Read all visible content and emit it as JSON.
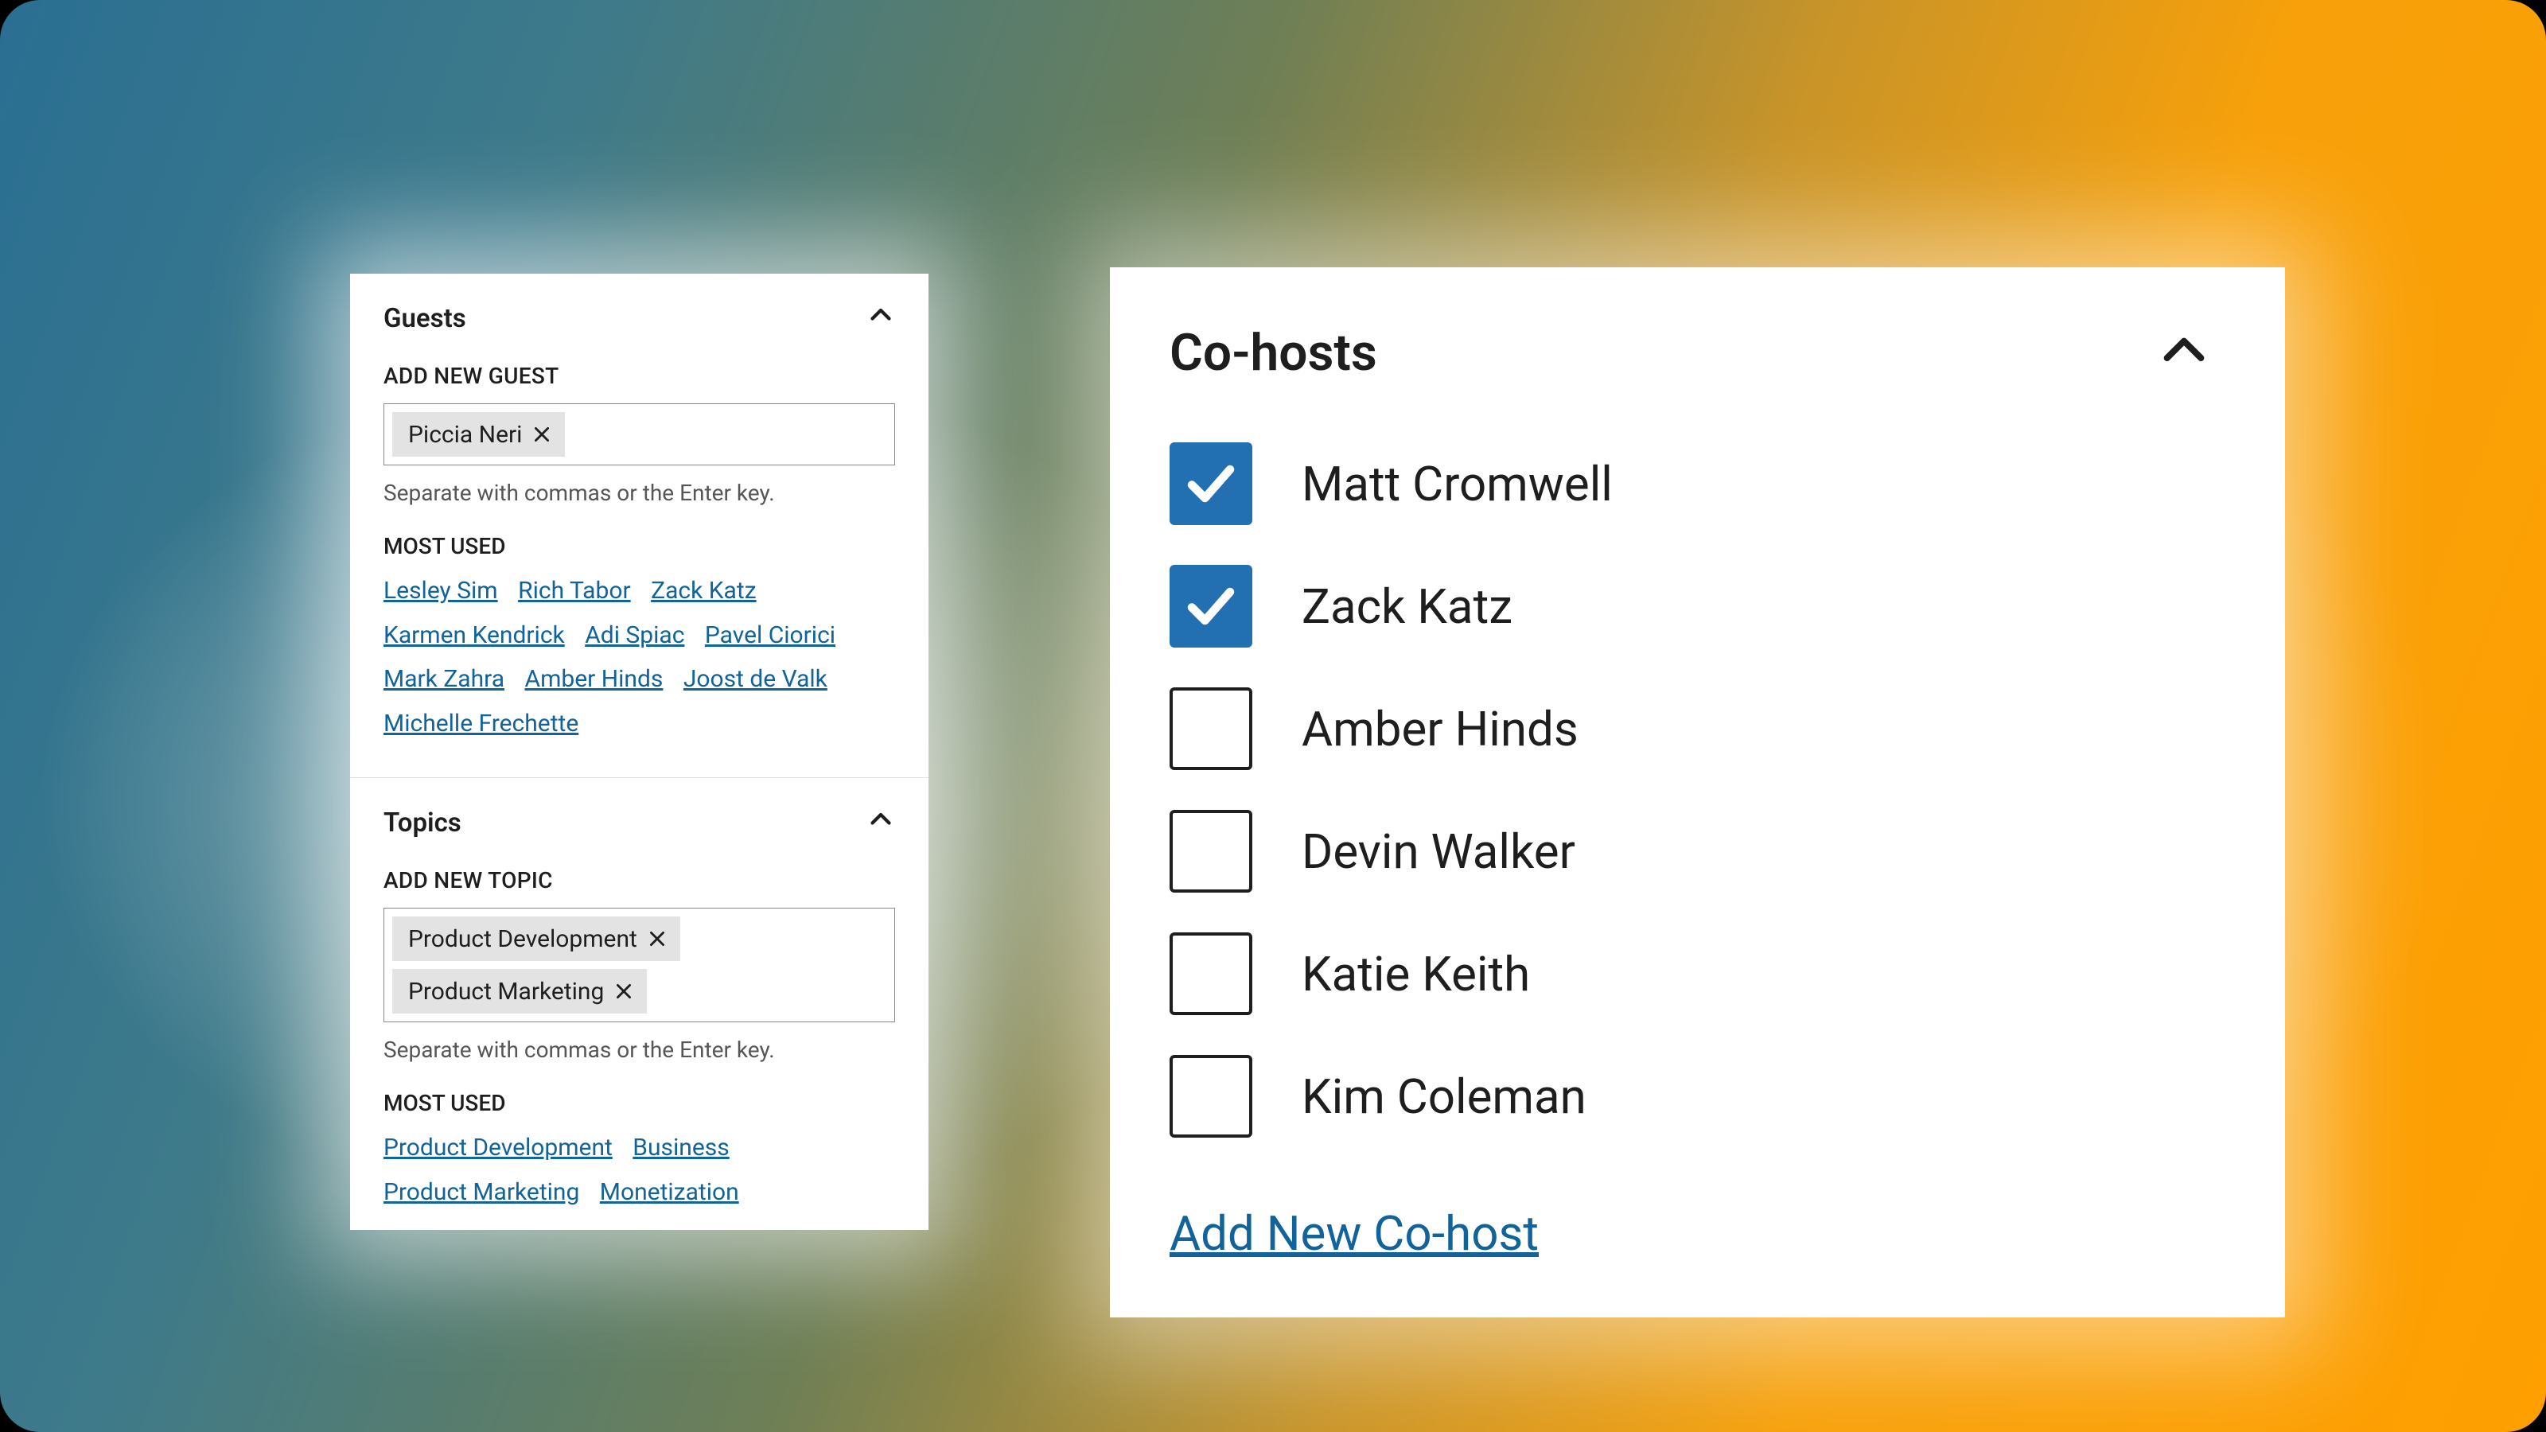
{
  "colors": {
    "link": "#116399",
    "checkbox_checked_bg": "#2270b1"
  },
  "guests": {
    "title": "Guests",
    "add_label": "ADD NEW GUEST",
    "chips": [
      "Piccia Neri"
    ],
    "helper": "Separate with commas or the Enter key.",
    "most_used_label": "MOST USED",
    "most_used": [
      "Lesley Sim",
      "Rich Tabor",
      "Zack Katz",
      "Karmen Kendrick",
      "Adi Spiac",
      "Pavel Ciorici",
      "Mark Zahra",
      "Amber Hinds",
      "Joost de Valk",
      "Michelle Frechette"
    ]
  },
  "topics": {
    "title": "Topics",
    "add_label": "ADD NEW TOPIC",
    "chips": [
      "Product Development",
      "Product Marketing"
    ],
    "helper": "Separate with commas or the Enter key.",
    "most_used_label": "MOST USED",
    "most_used": [
      "Product Development",
      "Business",
      "Product Marketing",
      "Monetization"
    ]
  },
  "cohosts": {
    "title": "Co-hosts",
    "items": [
      {
        "name": "Matt Cromwell",
        "checked": true
      },
      {
        "name": "Zack Katz",
        "checked": true
      },
      {
        "name": "Amber Hinds",
        "checked": false
      },
      {
        "name": "Devin Walker",
        "checked": false
      },
      {
        "name": "Katie Keith",
        "checked": false
      },
      {
        "name": "Kim Coleman",
        "checked": false
      }
    ],
    "add_new_label": "Add New Co-host"
  }
}
